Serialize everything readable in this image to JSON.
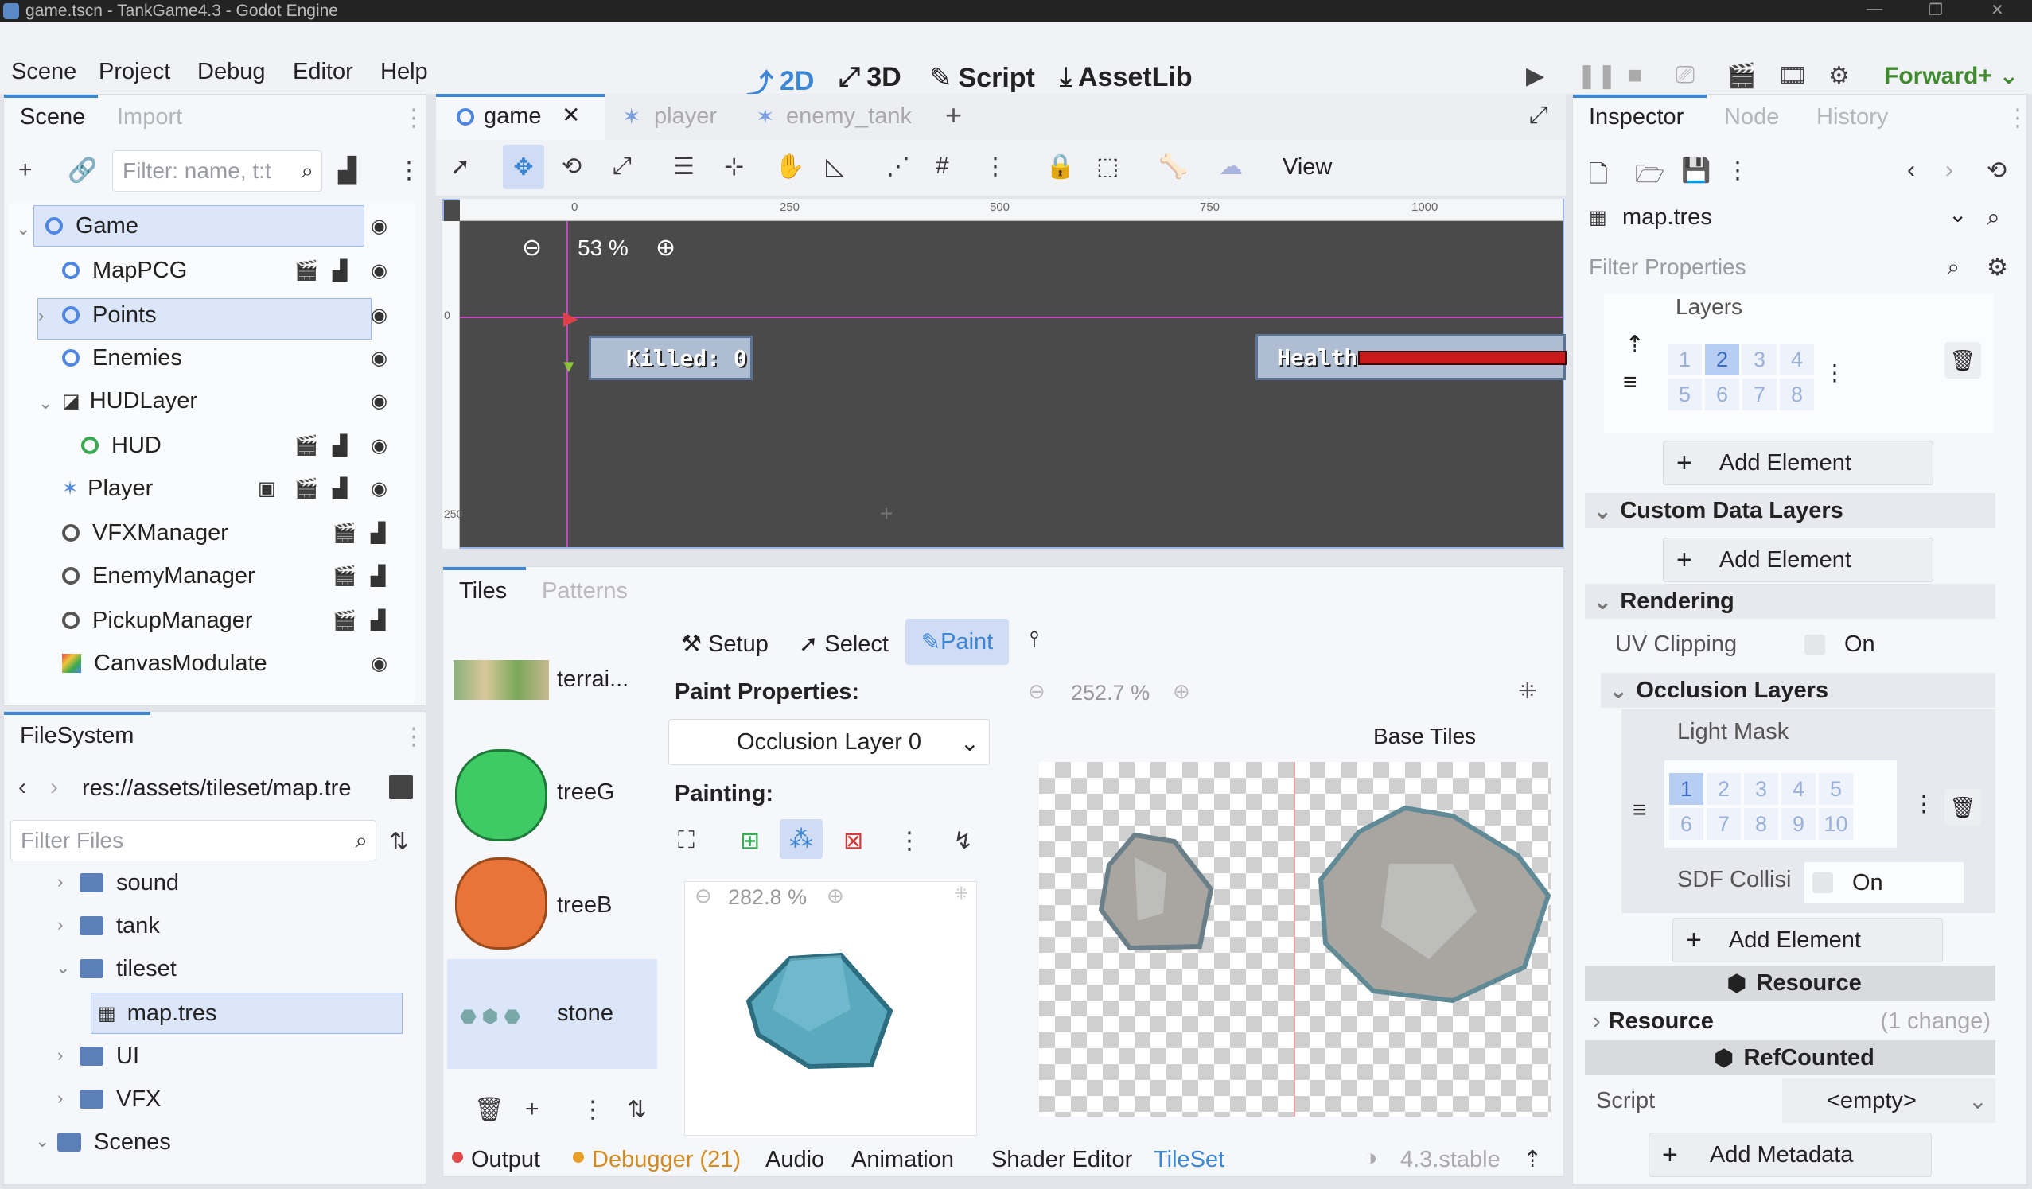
{
  "window": {
    "title": "game.tscn - TankGame4.3 - Godot Engine"
  },
  "menu": [
    "Scene",
    "Project",
    "Debug",
    "Editor",
    "Help"
  ],
  "modes": [
    {
      "label": "2D",
      "active": true
    },
    {
      "label": "3D",
      "active": false
    },
    {
      "label": "Script",
      "active": false
    },
    {
      "label": "AssetLib",
      "active": false
    }
  ],
  "renderer": "Forward+",
  "scene_dock": {
    "tabs": [
      "Scene",
      "Import"
    ],
    "filter_placeholder": "Filter: name, t:t",
    "nodes": [
      {
        "name": "Game",
        "selected": true
      },
      {
        "name": "MapPCG"
      },
      {
        "name": "Points"
      },
      {
        "name": "Enemies"
      },
      {
        "name": "HUDLayer"
      },
      {
        "name": "HUD"
      },
      {
        "name": "Player"
      },
      {
        "name": "VFXManager"
      },
      {
        "name": "EnemyManager"
      },
      {
        "name": "PickupManager"
      },
      {
        "name": "CanvasModulate"
      }
    ]
  },
  "filesystem": {
    "title": "FileSystem",
    "path": "res://assets/tileset/map.tre",
    "filter_placeholder": "Filter Files",
    "items": [
      {
        "name": "sound"
      },
      {
        "name": "tank"
      },
      {
        "name": "tileset"
      },
      {
        "name": "map.tres",
        "selected": true
      },
      {
        "name": "UI"
      },
      {
        "name": "VFX"
      },
      {
        "name": "Scenes"
      }
    ]
  },
  "editor_tabs": [
    {
      "label": "game",
      "active": true
    },
    {
      "label": "player"
    },
    {
      "label": "enemy_tank"
    }
  ],
  "toolbar": {
    "view_label": "View"
  },
  "viewport": {
    "zoom": "53 %",
    "killed_label": "Killed: 0",
    "health_label": "Health",
    "ruler_ticks": [
      "0",
      "250",
      "500",
      "750",
      "1000"
    ],
    "ruler_left": [
      "0",
      "250"
    ]
  },
  "tileset": {
    "tabs": [
      "Tiles",
      "Patterns"
    ],
    "sources": [
      {
        "name": "terrai..."
      },
      {
        "name": "treeG"
      },
      {
        "name": "treeB"
      },
      {
        "name": "stone",
        "selected": true
      }
    ],
    "modes": [
      "Setup",
      "Select",
      "Paint"
    ],
    "paint_properties": "Paint Properties:",
    "occlusion_layer": "Occlusion Layer 0",
    "painting": "Painting:",
    "tile_zoom": "282.8 %",
    "atlas_zoom": "252.7 %",
    "base_tiles": "Base Tiles"
  },
  "bottom": {
    "output": "Output",
    "debugger": "Debugger (21)",
    "audio": "Audio",
    "animation": "Animation",
    "shader_editor": "Shader Editor",
    "tileset": "TileSet",
    "version": "4.3.stable",
    "status_colors": {
      "output": "#e04a4a",
      "debugger": "#e8a02a",
      "active": "#3c86d6"
    }
  },
  "inspector": {
    "tabs": [
      "Inspector",
      "Node",
      "History"
    ],
    "resource": "map.tres",
    "filter_placeholder": "Filter Properties",
    "layers_label": "Layers",
    "layers": [
      "1",
      "2",
      "3",
      "4",
      "5",
      "6",
      "7",
      "8"
    ],
    "layers_on": "2",
    "add_element": "Add Element",
    "custom_data_layers": "Custom Data Layers",
    "rendering": "Rendering",
    "uv_clipping": "UV Clipping",
    "on": "On",
    "occlusion_layers": "Occlusion Layers",
    "light_mask": "Light Mask",
    "light_layers": [
      "1",
      "2",
      "3",
      "4",
      "5",
      "6",
      "7",
      "8",
      "9",
      "10"
    ],
    "light_on": "1",
    "sdf_collision": "SDF Collisi",
    "resource_section": "Resource",
    "resource_group": "Resource",
    "change_count": "(1 change)",
    "refcounted": "RefCounted",
    "script_label": "Script",
    "script_value": "<empty>",
    "add_metadata": "Add Metadata"
  }
}
